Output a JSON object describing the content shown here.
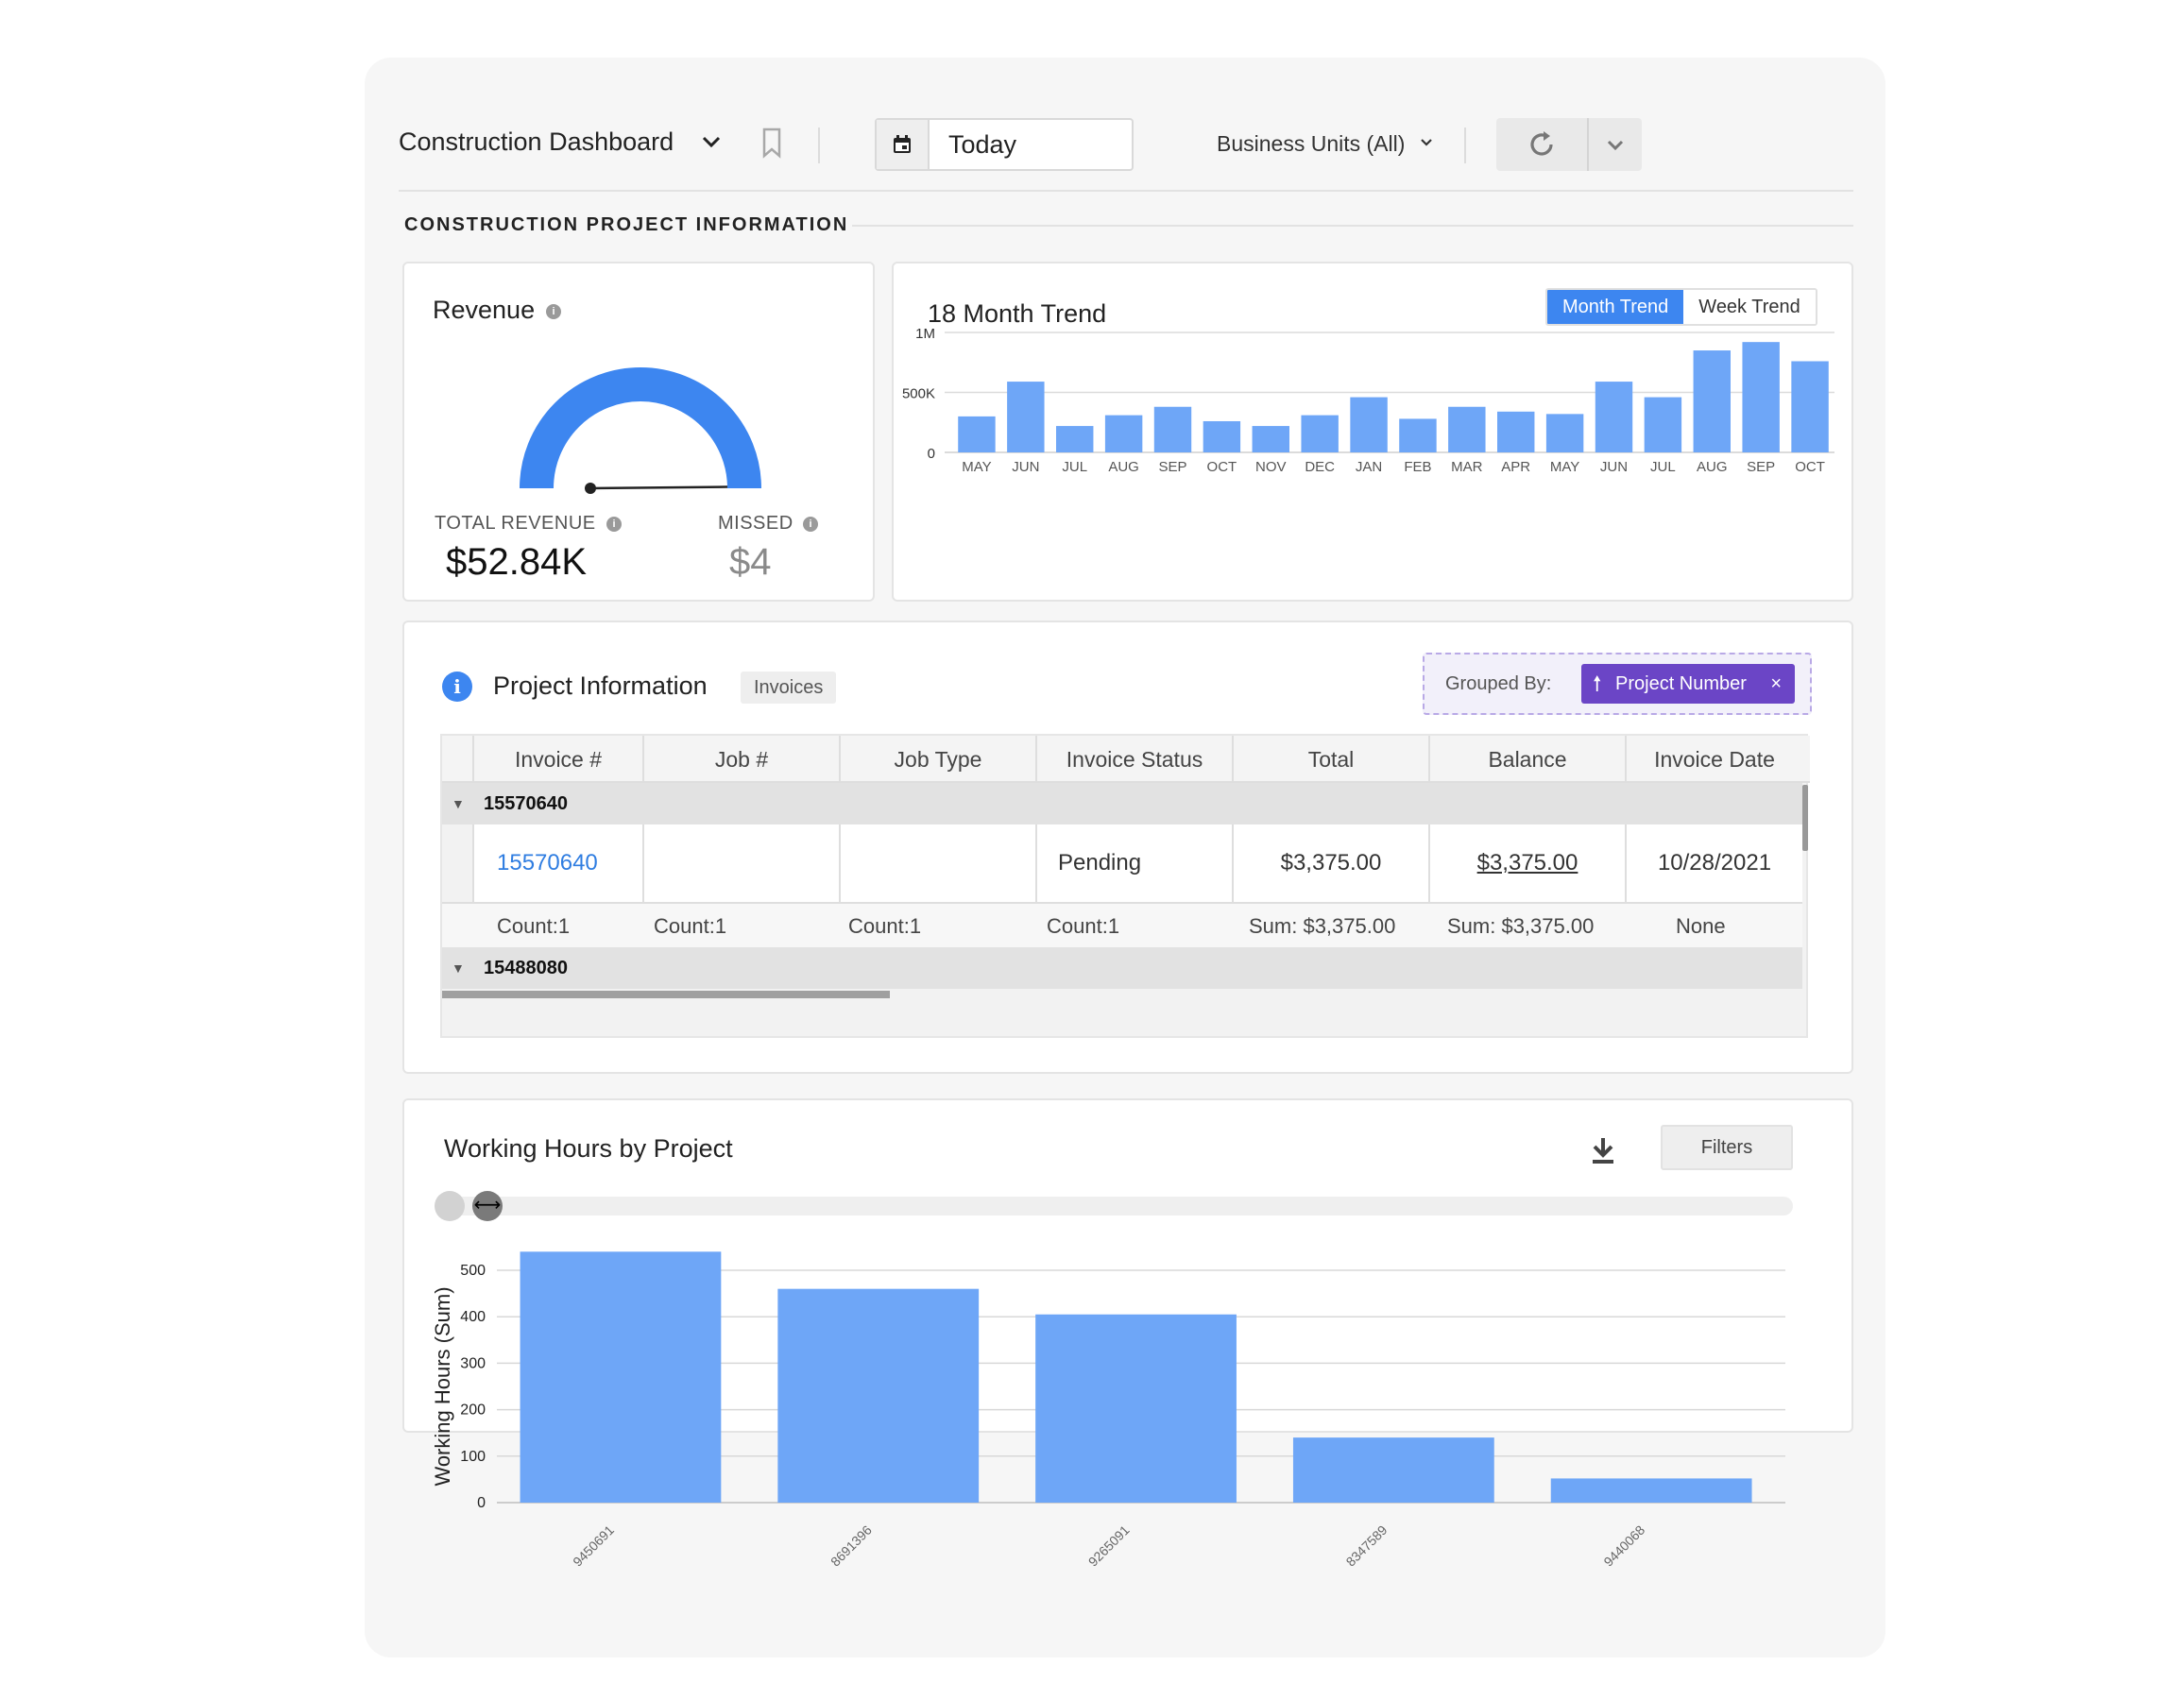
{
  "toolbar": {
    "dashboard_title": "Construction Dashboard",
    "date_value": "Today",
    "business_units": "Business Units (All)"
  },
  "section": {
    "title": "CONSTRUCTION PROJECT INFORMATION"
  },
  "revenue": {
    "title": "Revenue",
    "total_label": "TOTAL REVENUE",
    "total_value": "$52.84K",
    "missed_label": "MISSED",
    "missed_value": "$4",
    "gauge_fraction": 0.995
  },
  "trend": {
    "title": "18 Month Trend",
    "tabs": [
      "Month Trend",
      "Week Trend"
    ],
    "active_tab": "Month Trend"
  },
  "project_info": {
    "title": "Project Information",
    "tag": "Invoices",
    "grouped_label": "Grouped By:",
    "grouped_chip": "Project Number",
    "grouped_chip_arrow": "🠕",
    "grouped_chip_close": "×",
    "columns": [
      "Invoice #",
      "Job #",
      "Job Type",
      "Invoice Status",
      "Total",
      "Balance",
      "Invoice Date"
    ],
    "groups": [
      "15570640",
      "15488080"
    ],
    "row": {
      "invoice": "15570640",
      "job": "",
      "job_type": "",
      "status": "Pending",
      "total": "$3,375.00",
      "balance": "$3,375.00",
      "date": "10/28/2021"
    },
    "summary": [
      "Count:1",
      "Count:1",
      "Count:1",
      "Count:1",
      "Sum: $3,375.00",
      "Sum: $3,375.00",
      "None"
    ],
    "group_toggle": "▼"
  },
  "working_hours": {
    "title": "Working Hours by Project",
    "filters_label": "Filters",
    "slider_handle_glyph": "⟷"
  },
  "colors": {
    "accent": "#3d86f0",
    "bar": "#6ea6f7",
    "purple": "#6b45c6",
    "link": "#2f7de1"
  },
  "chart_data": [
    {
      "type": "bar",
      "title": "18 Month Trend",
      "categories": [
        "MAY",
        "JUN",
        "JUL",
        "AUG",
        "SEP",
        "OCT",
        "NOV",
        "DEC",
        "JAN",
        "FEB",
        "MAR",
        "APR",
        "MAY",
        "JUN",
        "JUL",
        "AUG",
        "SEP",
        "OCT"
      ],
      "values": [
        300000,
        590000,
        220000,
        310000,
        380000,
        260000,
        220000,
        310000,
        460000,
        280000,
        380000,
        340000,
        320000,
        590000,
        460000,
        850000,
        920000,
        760000
      ],
      "ylim": [
        0,
        1000000
      ],
      "yticks": [
        "0",
        "500K",
        "1M"
      ],
      "grid": true
    },
    {
      "type": "bar",
      "title": "",
      "xlabel": "",
      "ylabel": "Working Hours (Sum)",
      "categories": [
        "9450691",
        "8691396",
        "9265091",
        "8347589",
        "9440068"
      ],
      "values": [
        540,
        460,
        405,
        140,
        52
      ],
      "ylim": [
        0,
        500
      ],
      "yticks": [
        "0",
        "100",
        "200",
        "300",
        "400",
        "500"
      ],
      "grid": true
    }
  ]
}
